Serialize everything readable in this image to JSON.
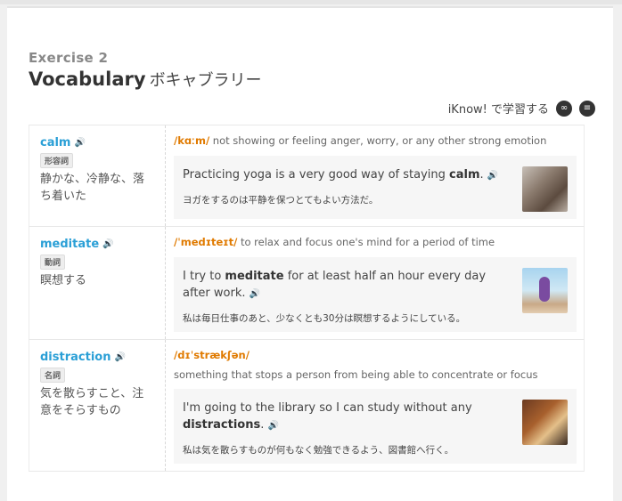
{
  "header": {
    "exercise_label": "Exercise 2",
    "title": "Vocabulary",
    "title_jp": "ボキャブラリー"
  },
  "iknow": {
    "label": "iKnow! で学習する",
    "icons": [
      "link-icon",
      "add-list-icon"
    ]
  },
  "words": [
    {
      "word": "calm",
      "pos": "形容詞",
      "jp_def": "静かな、冷静な、落ち着いた",
      "pron": "/kɑːm/",
      "definition": "not showing or feeling anger, worry, or any other strong emotion",
      "sentence_pre": "Practicing yoga is a very good way of staying ",
      "sentence_bold": "calm",
      "sentence_post": ".",
      "sentence_jp": "ヨガをするのは平静を保つとてもよい方法だ。"
    },
    {
      "word": "meditate",
      "pos": "動詞",
      "jp_def": "瞑想する",
      "pron": "/ˈmedɪteɪt/",
      "definition": "to relax and focus one's mind for a period of time",
      "sentence_pre": "I try to ",
      "sentence_bold": "meditate",
      "sentence_post": " for at least half an hour every day after work.",
      "sentence_jp": "私は毎日仕事のあと、少なくとも30分は瞑想するようにしている。"
    },
    {
      "word": "distraction",
      "pos": "名詞",
      "jp_def": "気を散らすこと、注意をそらすもの",
      "pron": "/dɪˈstrækʃən/",
      "definition": "something that stops a person from being able to concentrate or focus",
      "sentence_pre": "I'm going to the library so I can study without any ",
      "sentence_bold": "distractions",
      "sentence_post": ".",
      "sentence_jp": "私は気を散らすものが何もなく勉強できるよう、図書館へ行く。"
    }
  ]
}
